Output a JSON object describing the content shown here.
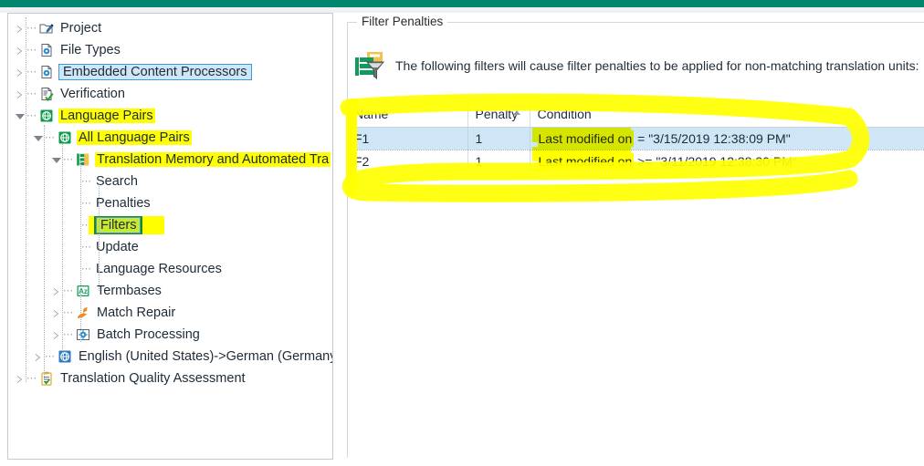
{
  "window": {
    "accent_color": "#00866e"
  },
  "tree": {
    "name": "navigation-tree",
    "items": [
      {
        "label": "Project",
        "icon": "project-icon",
        "indent": 0,
        "state": "collapsed",
        "highlight": false,
        "selected": false
      },
      {
        "label": "File Types",
        "icon": "file-types-icon",
        "indent": 0,
        "state": "collapsed",
        "highlight": false,
        "selected": false
      },
      {
        "label": "Embedded Content Processors",
        "icon": "file-types-icon",
        "indent": 0,
        "state": "collapsed",
        "highlight": false,
        "selected": true
      },
      {
        "label": "Verification",
        "icon": "verification-icon",
        "indent": 0,
        "state": "collapsed",
        "highlight": false,
        "selected": false
      },
      {
        "label": "Language Pairs",
        "icon": "language-pair-icon-green",
        "indent": 0,
        "state": "expanded",
        "highlight": true,
        "selected": false
      },
      {
        "label": "All Language Pairs",
        "icon": "language-pair-icon-green",
        "indent": 1,
        "state": "expanded",
        "highlight": true,
        "selected": false
      },
      {
        "label": "Translation Memory and Automated Tra",
        "icon": "translation-memory-icon",
        "indent": 2,
        "state": "expanded",
        "highlight": true,
        "selected": false
      },
      {
        "label": "Search",
        "icon": "none",
        "indent": 3,
        "state": "leaf",
        "highlight": false,
        "selected": false
      },
      {
        "label": "Penalties",
        "icon": "none",
        "indent": 3,
        "state": "leaf",
        "highlight": false,
        "selected": false
      },
      {
        "label": "Filters",
        "icon": "none",
        "indent": 3,
        "state": "leaf",
        "highlight": true,
        "selected": true
      },
      {
        "label": "Update",
        "icon": "none",
        "indent": 3,
        "state": "leaf",
        "highlight": false,
        "selected": false
      },
      {
        "label": "Language Resources",
        "icon": "none",
        "indent": 3,
        "state": "leaf",
        "highlight": false,
        "selected": false
      },
      {
        "label": "Termbases",
        "icon": "termbases-icon",
        "indent": 2,
        "state": "collapsed",
        "highlight": false,
        "selected": false
      },
      {
        "label": "Match Repair",
        "icon": "match-repair-icon",
        "indent": 2,
        "state": "collapsed",
        "highlight": false,
        "selected": false
      },
      {
        "label": "Batch Processing",
        "icon": "batch-processing-icon",
        "indent": 2,
        "state": "collapsed",
        "highlight": false,
        "selected": false
      },
      {
        "label": "English (United States)->German (Germany)",
        "icon": "language-pair-icon-blue",
        "indent": 1,
        "state": "collapsed",
        "highlight": false,
        "selected": false
      },
      {
        "label": "Translation Quality Assessment",
        "icon": "tqa-icon",
        "indent": 0,
        "state": "collapsed",
        "highlight": false,
        "selected": false
      }
    ]
  },
  "panel": {
    "group_title": "Filter Penalties",
    "description": "The following filters will cause filter penalties to be applied for non-matching translation units:",
    "description_icon": "filter-penalties-icon",
    "table": {
      "columns": [
        {
          "label": "Name",
          "sort": "none"
        },
        {
          "label": "Penalty",
          "sort": "asc"
        },
        {
          "label": "Condition",
          "sort": "none"
        }
      ],
      "rows": [
        {
          "name": "F1",
          "penalty": "1",
          "condition_field": "Last modified on",
          "condition_rest": "= \"3/15/2019 12:38:09 PM\"",
          "selected": true
        },
        {
          "name": "F2",
          "penalty": "1",
          "condition_field": "Last modified on",
          "condition_rest": ">= \"3/11/2019 12:38:30 PM\"",
          "selected": false
        }
      ]
    }
  },
  "annotations": {
    "highlighter_color": "#ffff00",
    "marker_color": "#1a8a28"
  }
}
